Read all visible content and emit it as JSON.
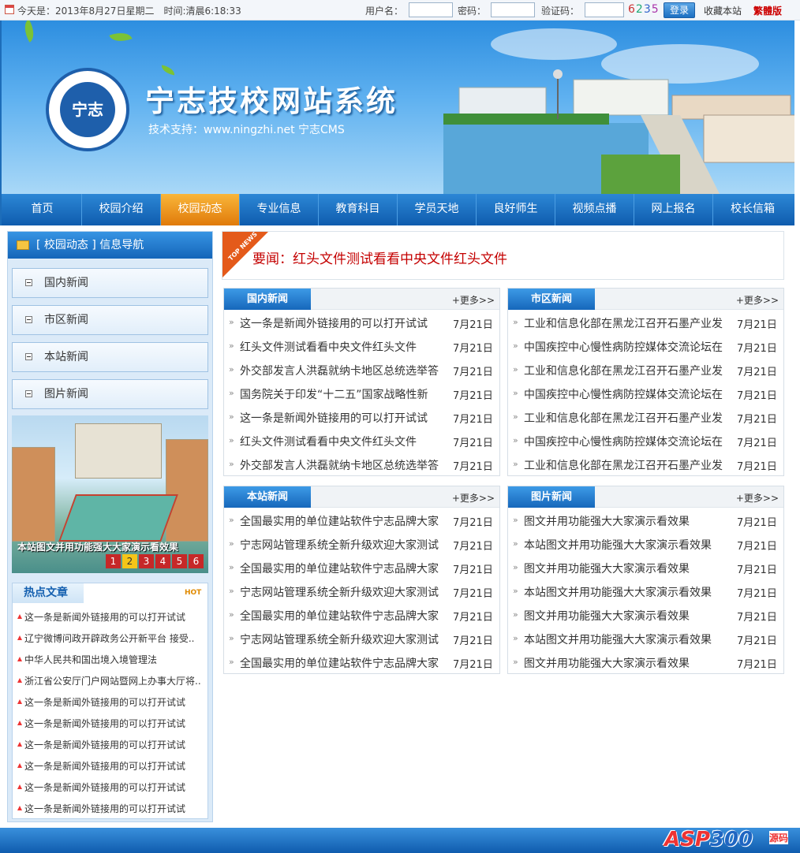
{
  "topbar": {
    "date_text": "今天是：2013年8月27日星期二　时间:清晨6:18:33",
    "username_label": "用户名：",
    "password_label": "密码：",
    "captcha_label": "验证码：",
    "captcha_digits": [
      "6",
      "2",
      "3",
      "5"
    ],
    "login_button": "登录",
    "favorite_link": "收藏本站",
    "traditional_link": "繁體版"
  },
  "banner": {
    "logo_text": "宁志",
    "title": "宁志技校网站系统",
    "support": "技术支持：www.ningzhi.net 宁志CMS"
  },
  "nav": {
    "items": [
      "首页",
      "校园介绍",
      "校园动态",
      "专业信息",
      "教育科目",
      "学员天地",
      "良好师生",
      "视频点播",
      "网上报名",
      "校长信箱"
    ],
    "active_index": 2
  },
  "sidebar": {
    "title": "[ 校园动态 ] 信息导航",
    "links": [
      "国内新闻",
      "市区新闻",
      "本站新闻",
      "图片新闻"
    ],
    "slide": {
      "caption": "本站图文并用功能强大大家演示看效果",
      "pages": [
        "1",
        "2",
        "3",
        "4",
        "5",
        "6"
      ],
      "active_page": 2
    },
    "hot": {
      "title": "热点文章",
      "badge": "HOT",
      "items": [
        "这一条是新闻外链接用的可以打开试试",
        "辽宁微博问政开辟政务公开新平台  接受..",
        "中华人民共和国出境入境管理法",
        "浙江省公安厅门户网站暨网上办事大厅将..",
        "这一条是新闻外链接用的可以打开试试",
        "这一条是新闻外链接用的可以打开试试",
        "这一条是新闻外链接用的可以打开试试",
        "这一条是新闻外链接用的可以打开试试",
        "这一条是新闻外链接用的可以打开试试",
        "这一条是新闻外链接用的可以打开试试"
      ]
    }
  },
  "headline": {
    "tag": "TOP NEWS",
    "text": "要闻：红头文件测试看看中央文件红头文件"
  },
  "boxes": [
    {
      "title": "国内新闻",
      "more": "+更多>>",
      "items": [
        {
          "text": "这一条是新闻外链接用的可以打开试试",
          "date": "7月21日"
        },
        {
          "text": "红头文件测试看看中央文件红头文件",
          "date": "7月21日"
        },
        {
          "text": "外交部发言人洪磊就纳卡地区总统选举答",
          "date": "7月21日"
        },
        {
          "text": "国务院关于印发“十二五”国家战略性新",
          "date": "7月21日"
        },
        {
          "text": "这一条是新闻外链接用的可以打开试试",
          "date": "7月21日"
        },
        {
          "text": "红头文件测试看看中央文件红头文件",
          "date": "7月21日"
        },
        {
          "text": "外交部发言人洪磊就纳卡地区总统选举答",
          "date": "7月21日"
        }
      ]
    },
    {
      "title": "市区新闻",
      "more": "+更多>>",
      "items": [
        {
          "text": "工业和信息化部在黑龙江召开石墨产业发",
          "date": "7月21日"
        },
        {
          "text": "中国疾控中心慢性病防控媒体交流论坛在",
          "date": "7月21日"
        },
        {
          "text": "工业和信息化部在黑龙江召开石墨产业发",
          "date": "7月21日"
        },
        {
          "text": "中国疾控中心慢性病防控媒体交流论坛在",
          "date": "7月21日"
        },
        {
          "text": "工业和信息化部在黑龙江召开石墨产业发",
          "date": "7月21日"
        },
        {
          "text": "中国疾控中心慢性病防控媒体交流论坛在",
          "date": "7月21日"
        },
        {
          "text": "工业和信息化部在黑龙江召开石墨产业发",
          "date": "7月21日"
        }
      ]
    },
    {
      "title": "本站新闻",
      "more": "+更多>>",
      "items": [
        {
          "text": "全国最实用的单位建站软件宁志品牌大家",
          "date": "7月21日"
        },
        {
          "text": "宁志网站管理系统全新升级欢迎大家测试",
          "date": "7月21日"
        },
        {
          "text": "全国最实用的单位建站软件宁志品牌大家",
          "date": "7月21日"
        },
        {
          "text": "宁志网站管理系统全新升级欢迎大家测试",
          "date": "7月21日"
        },
        {
          "text": "全国最实用的单位建站软件宁志品牌大家",
          "date": "7月21日"
        },
        {
          "text": "宁志网站管理系统全新升级欢迎大家测试",
          "date": "7月21日"
        },
        {
          "text": "全国最实用的单位建站软件宁志品牌大家",
          "date": "7月21日"
        }
      ]
    },
    {
      "title": "图片新闻",
      "more": "+更多>>",
      "items": [
        {
          "text": "图文并用功能强大大家演示看效果",
          "date": "7月21日"
        },
        {
          "text": "本站图文并用功能强大大家演示看效果",
          "date": "7月21日"
        },
        {
          "text": "图文并用功能强大大家演示看效果",
          "date": "7月21日"
        },
        {
          "text": "本站图文并用功能强大大家演示看效果",
          "date": "7月21日"
        },
        {
          "text": "图文并用功能强大大家演示看效果",
          "date": "7月21日"
        },
        {
          "text": "本站图文并用功能强大大家演示看效果",
          "date": "7月21日"
        },
        {
          "text": "图文并用功能强大大家演示看效果",
          "date": "7月21日"
        }
      ]
    }
  ],
  "footer": {
    "brand_asp": "ASP",
    "brand_300": "300",
    "brand_suffix": "源码"
  },
  "colors": {
    "nav_blue": "#1465b9",
    "nav_active": "#f0961f",
    "headline_red": "#c40000"
  }
}
